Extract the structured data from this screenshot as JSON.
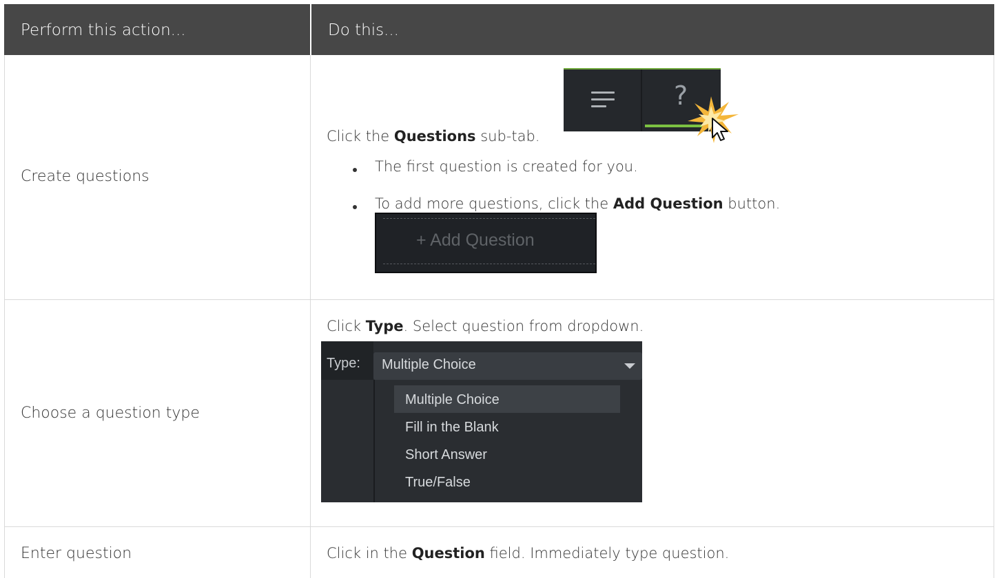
{
  "header": {
    "col1": "Perform this action...",
    "col2": "Do this..."
  },
  "rows": [
    {
      "action": "Create questions",
      "instruction_prefix": "Click the ",
      "instruction_bold": "Questions",
      "instruction_suffix": " sub-tab.",
      "bullets": [
        {
          "text": "The first question is created for you."
        },
        {
          "prefix": "To add more questions, click the ",
          "bold": "Add Question",
          "suffix": " button."
        }
      ],
      "subtab_image": {
        "question_glyph": "?",
        "menu_icon": "hamburger-icon",
        "accent": "#7cc142"
      },
      "add_question_image": {
        "label": "+ Add Question"
      }
    },
    {
      "action": "Choose a question type",
      "instruction_prefix": "Click ",
      "instruction_bold": "Type",
      "instruction_suffix": ". Select question from dropdown.",
      "dropdown_image": {
        "label": "Type:",
        "selected": "Multiple Choice",
        "options": [
          "Multiple Choice",
          "Fill in the Blank",
          "Short Answer",
          "True/False"
        ]
      }
    },
    {
      "action": "Enter question",
      "instruction_prefix": "Click in the ",
      "instruction_bold": "Question",
      "instruction_suffix": " field. Immediately type question."
    }
  ],
  "colors": {
    "header_bg": "#474747",
    "border": "#d9d9d9"
  }
}
